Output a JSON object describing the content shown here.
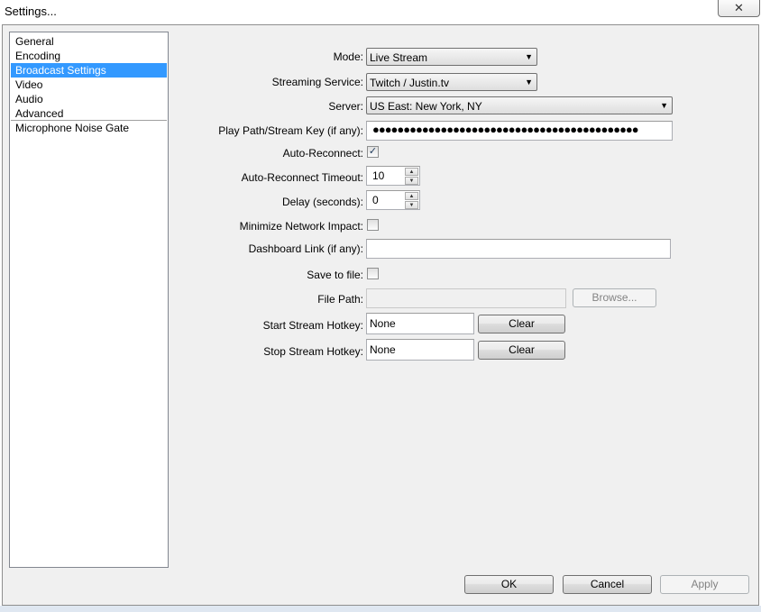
{
  "window": {
    "title": "Settings...",
    "close_icon": "✕"
  },
  "sidebar": {
    "items": [
      {
        "label": "General"
      },
      {
        "label": "Encoding"
      },
      {
        "label": "Broadcast Settings",
        "selected": true
      },
      {
        "label": "Video"
      },
      {
        "label": "Audio"
      },
      {
        "label": "Advanced"
      }
    ],
    "items2": [
      {
        "label": "Microphone Noise Gate"
      }
    ]
  },
  "form": {
    "mode": {
      "label": "Mode:",
      "value": "Live Stream"
    },
    "streaming_service": {
      "label": "Streaming Service:",
      "value": "Twitch / Justin.tv"
    },
    "server": {
      "label": "Server:",
      "value": "US East: New York, NY"
    },
    "play_path": {
      "label": "Play Path/Stream Key (if any):",
      "value": "●●●●●●●●●●●●●●●●●●●●●●●●●●●●●●●●●●●●●●●●●●●"
    },
    "auto_reconnect": {
      "label": "Auto-Reconnect:",
      "checked": true
    },
    "auto_reconnect_timeout": {
      "label": "Auto-Reconnect Timeout:",
      "value": "10"
    },
    "delay": {
      "label": "Delay (seconds):",
      "value": "0"
    },
    "minimize_network_impact": {
      "label": "Minimize Network Impact:",
      "checked": false
    },
    "dashboard_link": {
      "label": "Dashboard Link (if any):",
      "value": ""
    },
    "save_to_file": {
      "label": "Save to file:",
      "checked": false
    },
    "file_path": {
      "label": "File Path:",
      "value": "",
      "browse_label": "Browse..."
    },
    "start_stream_hotkey": {
      "label": "Start Stream Hotkey:",
      "value": "None",
      "clear_label": "Clear"
    },
    "stop_stream_hotkey": {
      "label": "Stop Stream Hotkey:",
      "value": "None",
      "clear_label": "Clear"
    }
  },
  "icons": {
    "dropdown": "▼",
    "spin_up": "▲",
    "spin_down": "▼",
    "check": "✓"
  },
  "footer": {
    "ok_label": "OK",
    "cancel_label": "Cancel",
    "apply_label": "Apply"
  }
}
